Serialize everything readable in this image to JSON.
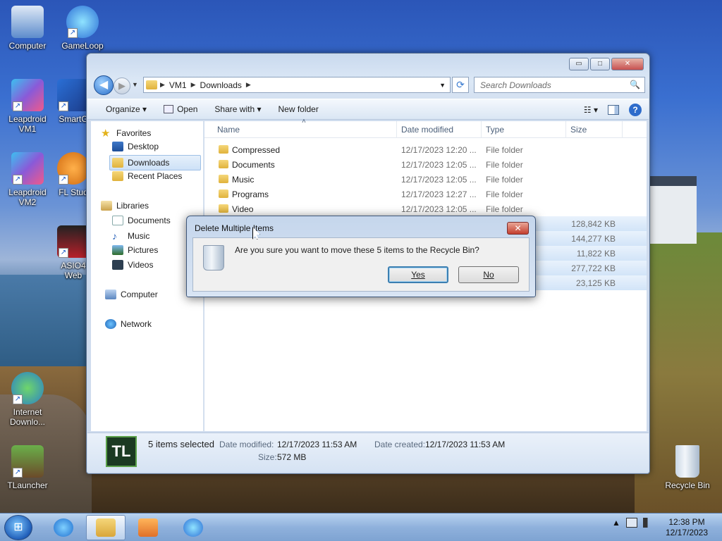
{
  "desktop": {
    "icons": [
      {
        "label": "Computer",
        "line2": ""
      },
      {
        "label": "GameLoop",
        "line2": ""
      },
      {
        "label": "Leapdroid",
        "line2": "VM1"
      },
      {
        "label": "SmartG",
        "line2": ""
      },
      {
        "label": "Leapdroid",
        "line2": "VM2"
      },
      {
        "label": "FL Stud",
        "line2": ""
      },
      {
        "label": "ASIO4",
        "line2": "Web"
      },
      {
        "label": "Internet",
        "line2": "Downlo..."
      },
      {
        "label": "TLauncher",
        "line2": ""
      },
      {
        "label": "Recycle Bin",
        "line2": ""
      }
    ]
  },
  "explorer": {
    "caption": {
      "minimize": "▭",
      "maximize": "□",
      "close": "✕"
    },
    "back_glyph": "◀",
    "forward_glyph": "▶",
    "history_glyph": "▼",
    "address": {
      "segments": [
        "VM1",
        "Downloads"
      ],
      "separator": "▶",
      "dropdown": "▼",
      "refresh": "⟳"
    },
    "search": {
      "placeholder": "Search Downloads",
      "icon": "🔍"
    },
    "toolbar": {
      "organize": "Organize ▾",
      "open": "Open",
      "share_with": "Share with ▾",
      "new_folder": "New folder",
      "views_glyph": "☷ ▾",
      "help": "?"
    },
    "nav": {
      "favorites": "Favorites",
      "desktop": "Desktop",
      "downloads": "Downloads",
      "recent_places": "Recent Places",
      "libraries": "Libraries",
      "documents": "Documents",
      "music": "Music",
      "pictures": "Pictures",
      "videos": "Videos",
      "computer": "Computer",
      "network": "Network"
    },
    "columns": {
      "name": "Name",
      "date_modified": "Date modified",
      "type": "Type",
      "size": "Size",
      "sort_glyph": "˄"
    },
    "folders": [
      {
        "name": "Compressed",
        "date": "12/17/2023 12:20 ...",
        "type": "File folder"
      },
      {
        "name": "Documents",
        "date": "12/17/2023 12:05 ...",
        "type": "File folder"
      },
      {
        "name": "Music",
        "date": "12/17/2023 12:05 ...",
        "type": "File folder"
      },
      {
        "name": "Programs",
        "date": "12/17/2023 12:27 ...",
        "type": "File folder"
      },
      {
        "name": "Video",
        "date": "12/17/2023 12:05 ...",
        "type": "File folder"
      }
    ],
    "selected_sizes": [
      "128,842 KB",
      "144,277 KB",
      "11,822 KB",
      "277,722 KB",
      "23,125 KB"
    ],
    "details": {
      "icon_text": "TL",
      "selection": "5 items selected",
      "date_modified_label": "Date modified:",
      "date_modified": "12/17/2023 11:53 AM",
      "date_created_label": "Date created:",
      "date_created": "12/17/2023 11:53 AM",
      "size_label": "Size:",
      "size": "572 MB"
    }
  },
  "dialog": {
    "title": "Delete Multiple Items",
    "close": "✕",
    "message": "Are you sure you want to move these 5 items to the Recycle Bin?",
    "yes": "Yes",
    "no": "No"
  },
  "taskbar": {
    "start_glyph": "⊞",
    "tray_arrow": "▲",
    "clock_time": "12:38 PM",
    "clock_date": "12/17/2023"
  }
}
